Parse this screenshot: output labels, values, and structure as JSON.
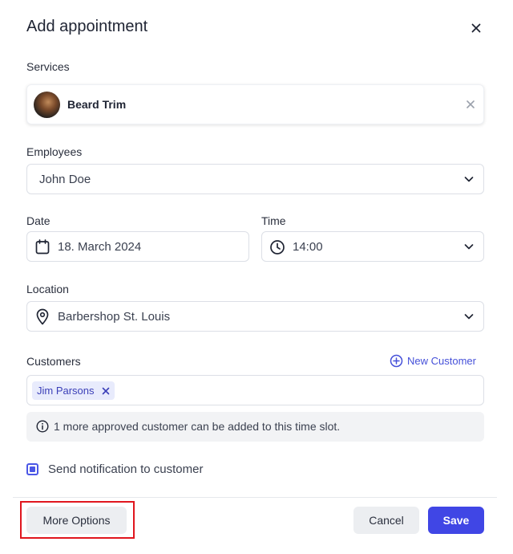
{
  "dialog": {
    "title": "Add appointment"
  },
  "services": {
    "label": "Services",
    "selected": {
      "name": "Beard Trim"
    }
  },
  "employees": {
    "label": "Employees",
    "value": "John Doe"
  },
  "date": {
    "label": "Date",
    "value": "18. March 2024"
  },
  "time": {
    "label": "Time",
    "value": "14:00"
  },
  "location": {
    "label": "Location",
    "value": "Barbershop St. Louis"
  },
  "customers": {
    "label": "Customers",
    "new_customer_label": "New Customer",
    "selected": [
      {
        "name": "Jim Parsons"
      }
    ],
    "info_text": "1 more approved customer can be added to this time slot."
  },
  "notification": {
    "label": "Send notification to customer",
    "checked": true
  },
  "footer": {
    "more_options_label": "More Options",
    "cancel_label": "Cancel",
    "save_label": "Save"
  },
  "colors": {
    "accent": "#4046e5",
    "highlight": "#e0161e",
    "tag_bg": "#e8ebfc"
  },
  "icons": {
    "close": "close-icon",
    "calendar": "calendar-icon",
    "clock": "clock-icon",
    "location": "map-pin-icon",
    "chevron": "chevron-down-icon",
    "add": "plus-circle-icon",
    "info": "info-icon"
  }
}
